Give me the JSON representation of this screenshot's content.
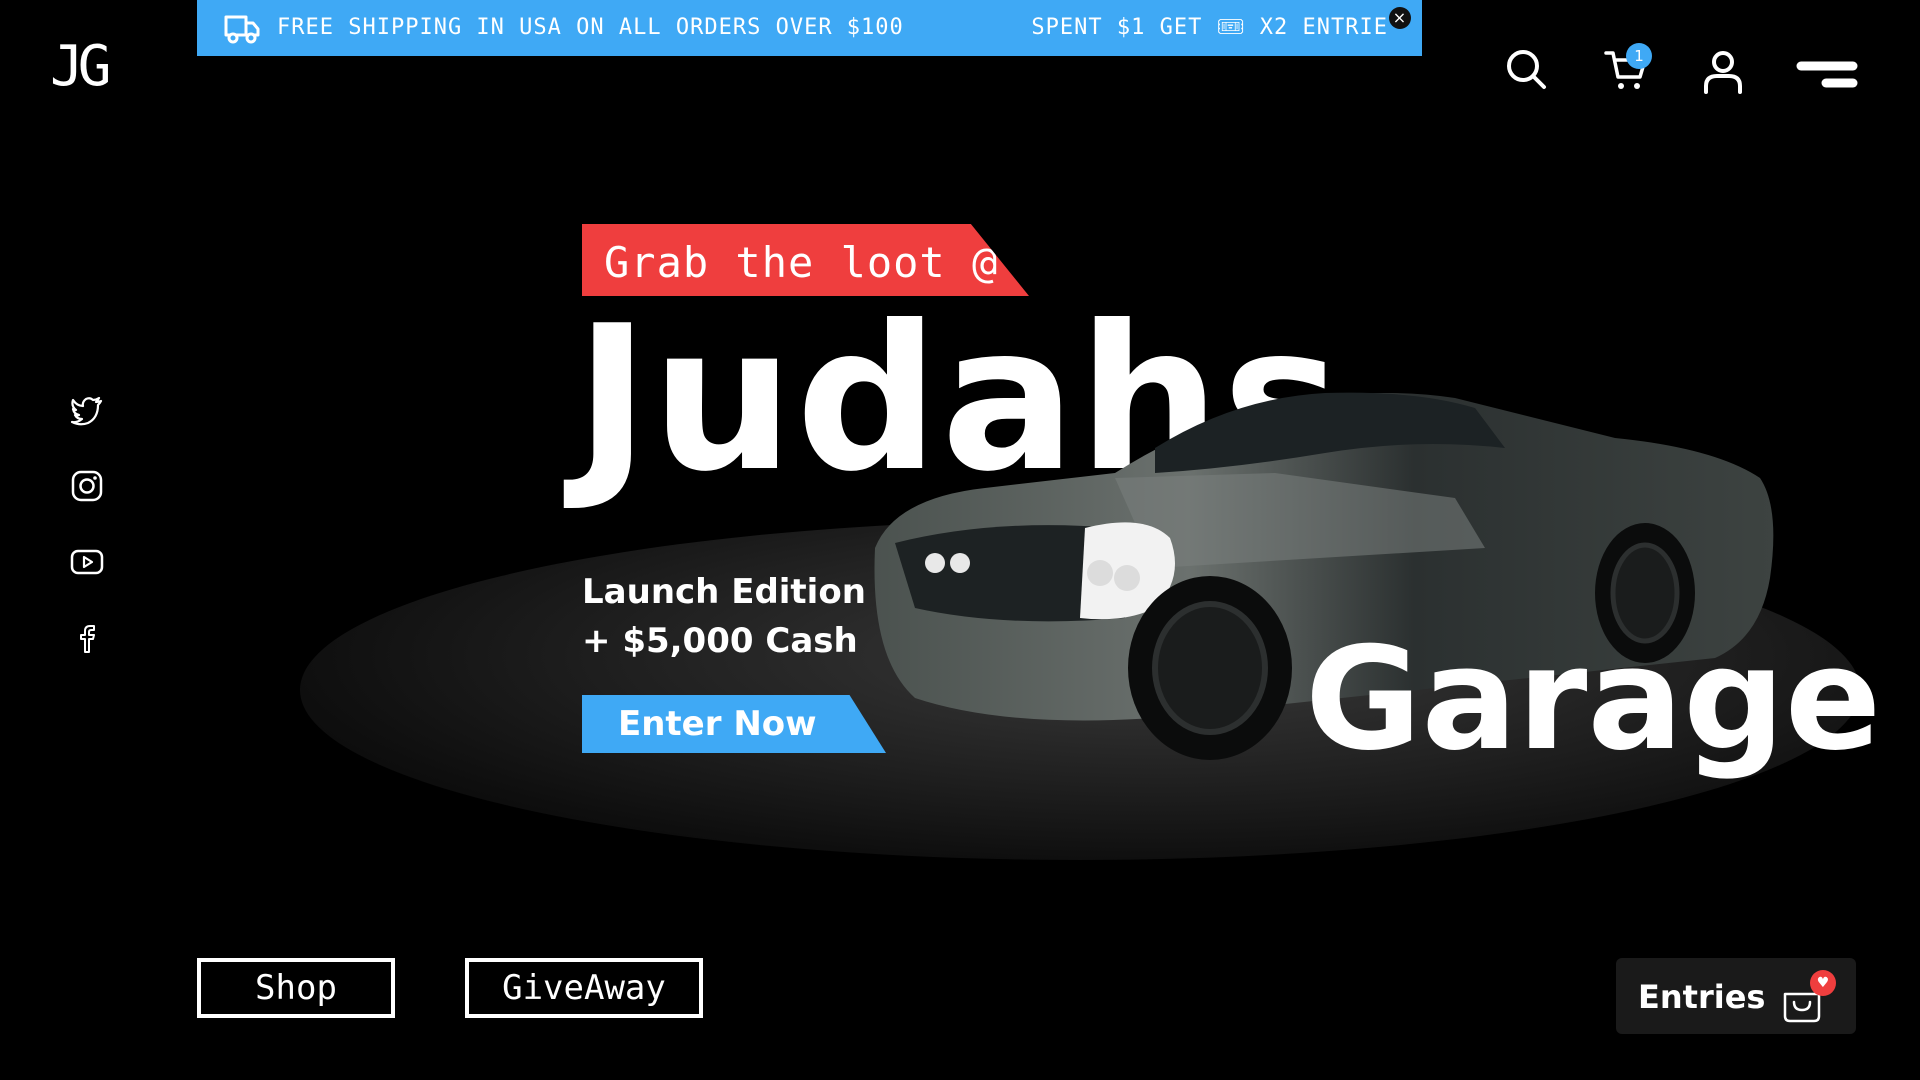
{
  "logo": {
    "text": "JG"
  },
  "banner": {
    "shipping_text": "FREE SHIPPING IN USA ON ALL ORDERS OVER $100",
    "promo_text": "SPENT $1 GET 🎟 X2 ENTRIE",
    "close_label": "×",
    "icon": "truck-icon",
    "background_color": "#3fa9f5"
  },
  "header": {
    "icons": [
      "search-icon",
      "cart-icon",
      "user-icon",
      "menu-icon"
    ],
    "cart_count": "1"
  },
  "social": [
    "twitter-icon",
    "instagram-icon",
    "youtube-icon",
    "facebook-icon"
  ],
  "hero": {
    "tag_text": "Grab the loot  @",
    "title_line1": "Judahs",
    "title_line2": "Garage",
    "edition_line1": "Launch Edition",
    "edition_line2": "+ $5,000 Cash",
    "cta_label": "Enter Now",
    "tag_color": "#ef3e3e",
    "accent_color": "#3fa9f5"
  },
  "footer_nav": {
    "shop_label": "Shop",
    "giveaway_label": "GiveAway"
  },
  "entries": {
    "label": "Entries",
    "badge": "♥"
  }
}
